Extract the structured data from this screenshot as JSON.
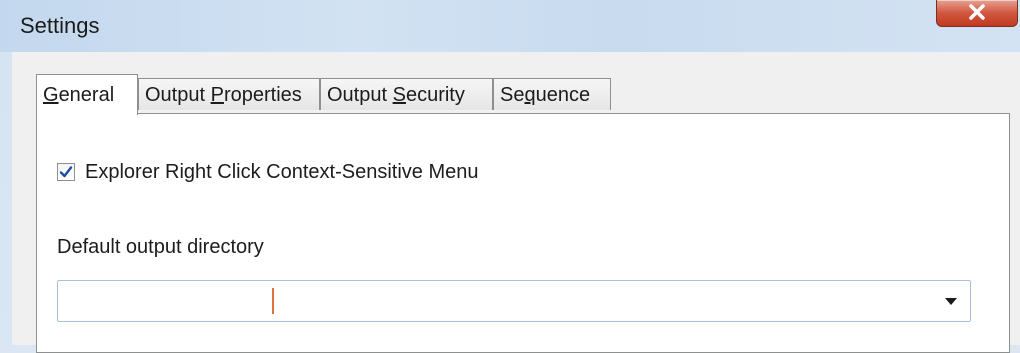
{
  "window": {
    "title": "Settings",
    "close_icon": "close-icon"
  },
  "tabs": [
    {
      "pre": "",
      "key": "G",
      "post": "eneral",
      "active": true
    },
    {
      "pre": "Output ",
      "key": "P",
      "post": "roperties",
      "active": false
    },
    {
      "pre": "Output ",
      "key": "S",
      "post": "ecurity",
      "active": false
    },
    {
      "pre": "Se",
      "key": "q",
      "post": "uence",
      "active": false
    }
  ],
  "general": {
    "context_menu_checkbox": {
      "label": "Explorer Right Click Context-Sensitive Menu",
      "checked": true
    },
    "output_directory": {
      "label": "Default output directory",
      "value": "",
      "dropdown_icon": "chevron-down-icon"
    }
  },
  "colors": {
    "close_button": "#c94a31",
    "check_mark": "#1f4fa3",
    "caret": "#d9773a"
  }
}
